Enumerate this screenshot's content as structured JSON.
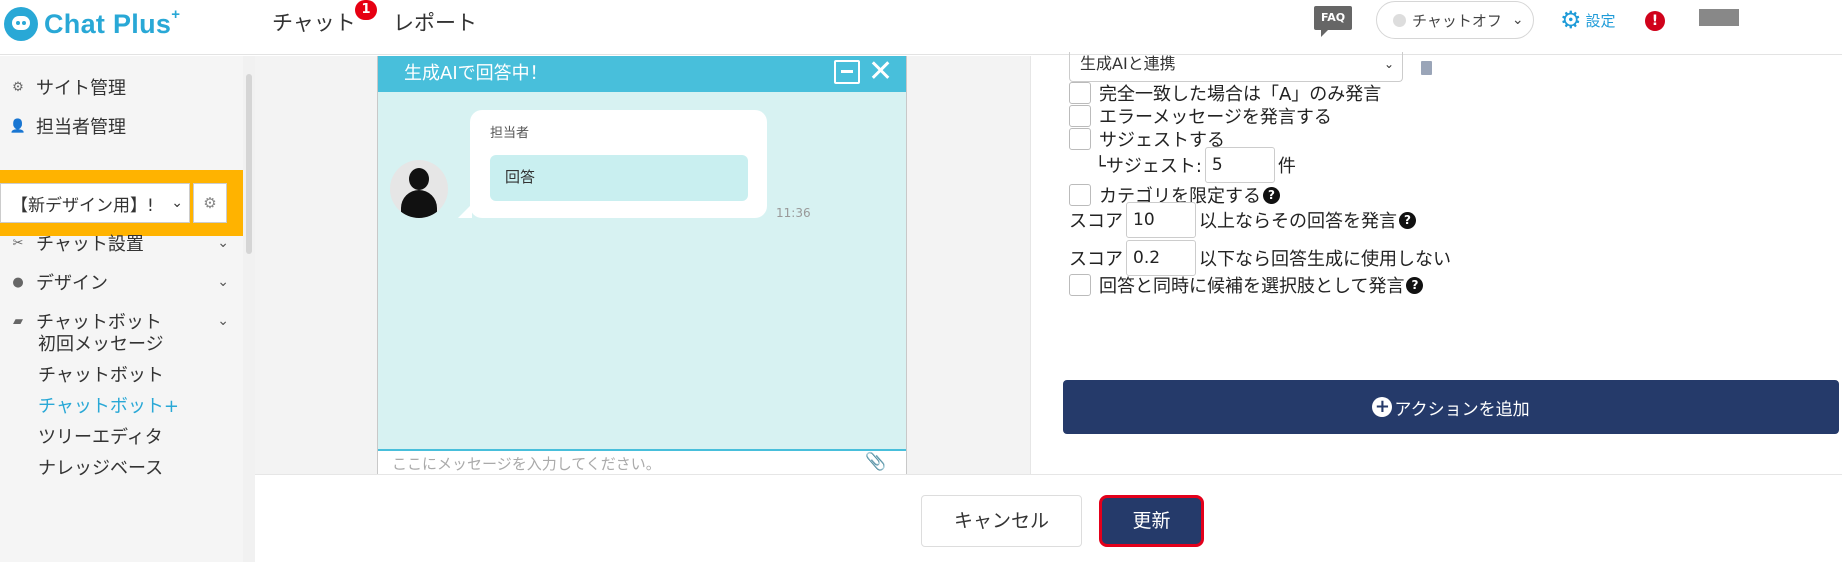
{
  "header": {
    "logo_text": "Chat Plus",
    "logo_plus": "+",
    "nav_chat": "チャット",
    "chat_badge": "1",
    "nav_report": "レポート",
    "faq": "FAQ",
    "chat_status": "チャットオフ",
    "settings": "設定",
    "alert": "!"
  },
  "sidebar": {
    "site_management": "サイト管理",
    "staff_management": "担当者管理",
    "site_select_value": "【新デザイン用】!",
    "chat_setup": "チャット設置",
    "design": "デザイン",
    "chatbot": "チャットボット",
    "sub_items": [
      "初回メッセージ",
      "チャットボット",
      "チャットボット+",
      "ツリーエディタ",
      "ナレッジベース"
    ]
  },
  "chat_preview": {
    "title": "生成AIで回答中！",
    "agent_name": "担当者",
    "answer": "回答",
    "time": "11:36",
    "input_placeholder": "ここにメッセージを入力してください。"
  },
  "settings_panel": {
    "select_value": "生成AIと連携",
    "exact_match": "完全一致した場合は「A」のみ発言",
    "error_message": "エラーメッセージを発言する",
    "suggest": "サジェストする",
    "suggest_count_label": "└サジェスト:",
    "suggest_count": "5",
    "suggest_unit": "件",
    "limit_category": "カテゴリを限定する",
    "score_label": "スコア",
    "score_high": "10",
    "score_high_suffix": "以上ならその回答を発言",
    "score_low": "0.2",
    "score_low_suffix": "以下なら回答生成に使用しない",
    "candidates_as_choices": "回答と同時に候補を選択肢として発言",
    "add_action": "アクションを追加"
  },
  "footer": {
    "cancel": "キャンセル",
    "update": "更新"
  }
}
